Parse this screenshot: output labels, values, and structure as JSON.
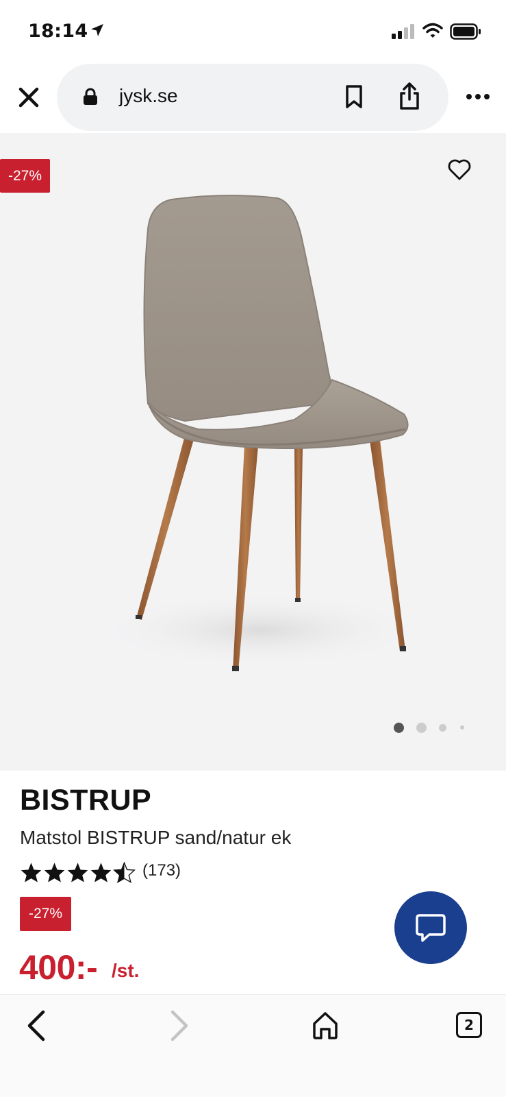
{
  "status_bar": {
    "time": "18:14",
    "icons": [
      "location-arrow-icon",
      "cellular-signal-icon",
      "wifi-icon",
      "battery-icon"
    ]
  },
  "browser": {
    "url": "jysk.se",
    "icons": [
      "close-icon",
      "lock-icon",
      "bookmark-icon",
      "share-icon",
      "more-icon"
    ]
  },
  "gallery": {
    "discount_badge": "-27%",
    "favorite_icon": "heart-icon",
    "page_dots": 4,
    "active_dot": 1
  },
  "product": {
    "brand": "BISTRUP",
    "name": "Matstol BISTRUP sand/natur ek",
    "rating": 4.5,
    "rating_max": 5,
    "review_count": "(173)",
    "discount_badge": "-27%",
    "price": "400:-",
    "unit": "/st."
  },
  "chat": {
    "icon": "chat-bubble-icon",
    "color": "#1a3f8f"
  },
  "bottom_nav": {
    "tab_count": "2",
    "icons": [
      "back-icon",
      "forward-icon",
      "home-icon",
      "tabs-icon"
    ]
  },
  "colors": {
    "sale_red": "#c8202f",
    "hero_bg": "#f3f3f4"
  }
}
